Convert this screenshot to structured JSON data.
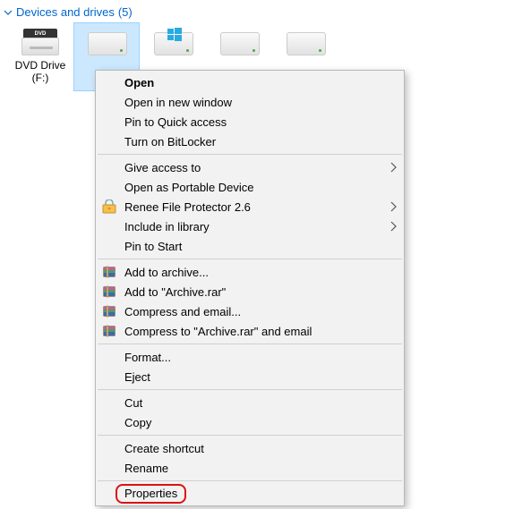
{
  "section": {
    "title": "Devices and drives",
    "count": "(5)"
  },
  "drives": [
    {
      "type": "dvd",
      "label_line1": "DVD Drive",
      "label_line2": "(F:)",
      "topText": "DVD"
    },
    {
      "type": "hdd",
      "selected": true
    },
    {
      "type": "hdd",
      "overlay": "windows"
    },
    {
      "type": "hdd"
    },
    {
      "type": "hdd"
    }
  ],
  "menu": {
    "open": "Open",
    "open_new_window": "Open in new window",
    "pin_quick_access": "Pin to Quick access",
    "bitlocker": "Turn on BitLocker",
    "give_access": "Give access to",
    "open_portable": "Open as Portable Device",
    "renee": "Renee File Protector 2.6",
    "include_library": "Include in library",
    "pin_start": "Pin to Start",
    "add_archive": "Add to archive...",
    "add_archive_rar": "Add to \"Archive.rar\"",
    "compress_email": "Compress and email...",
    "compress_rar_email": "Compress to \"Archive.rar\" and email",
    "format": "Format...",
    "eject": "Eject",
    "cut": "Cut",
    "copy": "Copy",
    "create_shortcut": "Create shortcut",
    "rename": "Rename",
    "properties": "Properties"
  }
}
